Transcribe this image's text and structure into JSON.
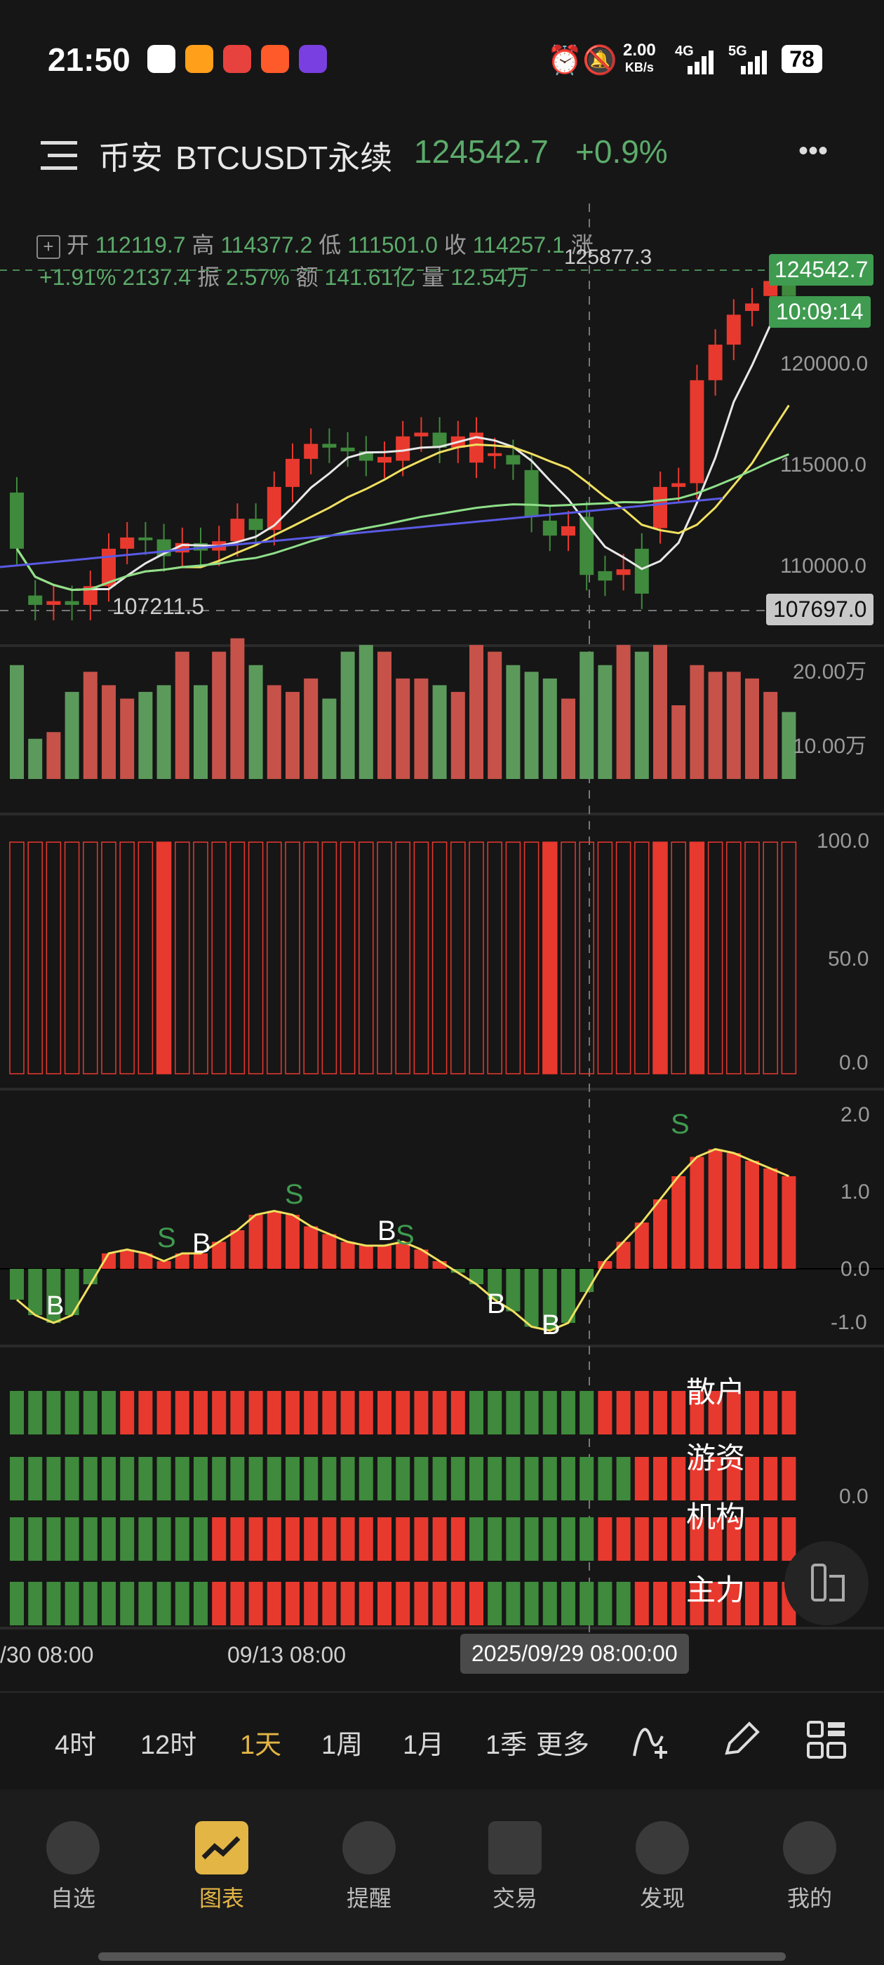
{
  "status_bar": {
    "time": "21:50",
    "net_speed": "2.00",
    "net_unit": "KB/s",
    "sig1": "4G",
    "sig2": "5G",
    "battery": "78"
  },
  "header": {
    "exchange": "币安",
    "symbol": "BTCUSDT永续",
    "price": "124542.7",
    "change": "+0.9%",
    "menu_label": "•••"
  },
  "ohlc": {
    "open_label": "开",
    "open": "112119.7",
    "high_label": "高",
    "high": "114377.2",
    "low_label": "低",
    "low": "111501.0",
    "close_label": "收",
    "close": "114257.1",
    "rise_label": "涨",
    "change_pct": "+1.91%",
    "change_abs": "2137.4",
    "amp_label": "振",
    "amp": "2.57%",
    "amount_label": "额",
    "amount": "141.61亿",
    "vol_label": "量",
    "vol": "12.54万"
  },
  "price_axis": {
    "last_price": "124542.7",
    "countdown": "10:09:14",
    "ticks": [
      "120000.0",
      "115000.0",
      "110000.0"
    ],
    "crosshair_price": "107697.0",
    "high_marker": "125877.3",
    "low_marker": "107211.5"
  },
  "volume_axis": {
    "ticks": [
      "20.00万",
      "10.00万"
    ]
  },
  "indicator1_axis": {
    "ticks": [
      "100.0",
      "50.0",
      "0.0"
    ]
  },
  "indicator2_axis": {
    "ticks": [
      "2.0",
      "1.0",
      "0.0",
      "-1.0"
    ]
  },
  "signals": [
    "B",
    "S",
    "B",
    "S",
    "B",
    "S",
    "B",
    "B",
    "S"
  ],
  "flow_rows": {
    "retail": "散户",
    "hot_money": "游资",
    "institution": "机构",
    "main": "主力",
    "axis_zero": "0.0"
  },
  "time_axis": {
    "t1": "/30 08:00",
    "t2": "09/13 08:00",
    "crosshair_time": "2025/09/29 08:00:00"
  },
  "timeframes": [
    "4时",
    "12时",
    "1天",
    "1周",
    "1月",
    "1季",
    "更多"
  ],
  "active_timeframe": "1天",
  "nav": [
    {
      "label": "自选",
      "icon": "watchlist-icon"
    },
    {
      "label": "图表",
      "icon": "chart-icon"
    },
    {
      "label": "提醒",
      "icon": "bell-icon"
    },
    {
      "label": "交易",
      "icon": "trade-icon"
    },
    {
      "label": "发现",
      "icon": "discover-icon"
    },
    {
      "label": "我的",
      "icon": "profile-icon"
    }
  ],
  "colors": {
    "up": "#e8392e",
    "down": "#3f8a3c",
    "green_text": "#5cab6b",
    "active": "#e3b544"
  },
  "chart_data": {
    "type": "candlestick",
    "candles": [
      {
        "o": 114000,
        "c": 111000
      },
      {
        "o": 108500,
        "c": 108000
      },
      {
        "o": 108000,
        "c": 108200
      },
      {
        "o": 108200,
        "c": 108000
      },
      {
        "o": 108000,
        "c": 109000
      },
      {
        "o": 109000,
        "c": 111000
      },
      {
        "o": 111000,
        "c": 111600
      },
      {
        "o": 111600,
        "c": 111500
      },
      {
        "o": 111500,
        "c": 110600
      },
      {
        "o": 110800,
        "c": 111300
      },
      {
        "o": 111300,
        "c": 110900
      },
      {
        "o": 110900,
        "c": 111400
      },
      {
        "o": 111400,
        "c": 112600
      },
      {
        "o": 112600,
        "c": 112000
      },
      {
        "o": 112000,
        "c": 114300
      },
      {
        "o": 114300,
        "c": 115800
      },
      {
        "o": 115800,
        "c": 116600
      },
      {
        "o": 116600,
        "c": 116400
      },
      {
        "o": 116400,
        "c": 116200
      },
      {
        "o": 116200,
        "c": 115700
      },
      {
        "o": 115600,
        "c": 115900
      },
      {
        "o": 115700,
        "c": 117000
      },
      {
        "o": 117000,
        "c": 117200
      },
      {
        "o": 117200,
        "c": 116400
      },
      {
        "o": 116400,
        "c": 117000
      },
      {
        "o": 115600,
        "c": 117200
      },
      {
        "o": 116100,
        "c": 116100
      },
      {
        "o": 116000,
        "c": 115500
      },
      {
        "o": 115200,
        "c": 112700
      },
      {
        "o": 112500,
        "c": 111700
      },
      {
        "o": 111700,
        "c": 112200
      },
      {
        "o": 112700,
        "c": 109600
      },
      {
        "o": 109800,
        "c": 109300
      },
      {
        "o": 109600,
        "c": 109900
      },
      {
        "o": 111000,
        "c": 108600
      },
      {
        "o": 112100,
        "c": 114300
      },
      {
        "o": 114300,
        "c": 114500
      },
      {
        "o": 114500,
        "c": 120000
      },
      {
        "o": 120000,
        "c": 121900
      },
      {
        "o": 121900,
        "c": 123500
      },
      {
        "o": 123700,
        "c": 124100
      },
      {
        "o": 124500,
        "c": 125300
      },
      {
        "o": 125300,
        "c": 124500
      }
    ],
    "volumes": [
      17,
      6,
      7,
      13,
      16,
      14,
      12,
      13,
      14,
      19,
      14,
      19,
      21,
      17,
      14,
      13,
      15,
      12,
      19,
      20,
      19,
      15,
      15,
      14,
      13,
      20,
      19,
      17,
      16,
      15,
      12,
      19,
      17,
      20,
      19,
      20,
      11,
      17,
      16,
      16,
      15,
      13,
      10
    ]
  }
}
